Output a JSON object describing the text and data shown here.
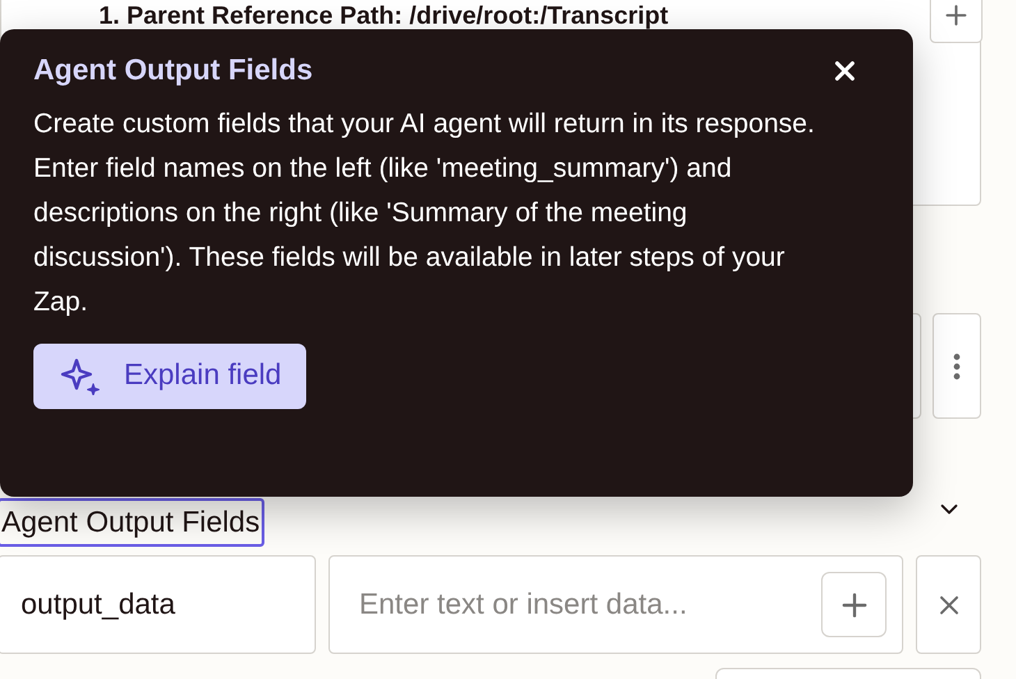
{
  "background": {
    "parent_reference_path": "1. Parent Reference Path: /drive/root:/Transcript"
  },
  "popover": {
    "title": "Agent Output Fields",
    "body": "Create custom fields that your AI agent will return in its response. Enter field names on the left (like 'meeting_summary') and descriptions on the right (like 'Summary of the meeting discussion'). These fields will be available in later steps of your Zap.",
    "button": "Explain field"
  },
  "field": {
    "label": "Agent Output Fields",
    "expanded": true,
    "rows": [
      {
        "name": "output_data",
        "placeholder": "Enter text or insert data..."
      }
    ]
  }
}
